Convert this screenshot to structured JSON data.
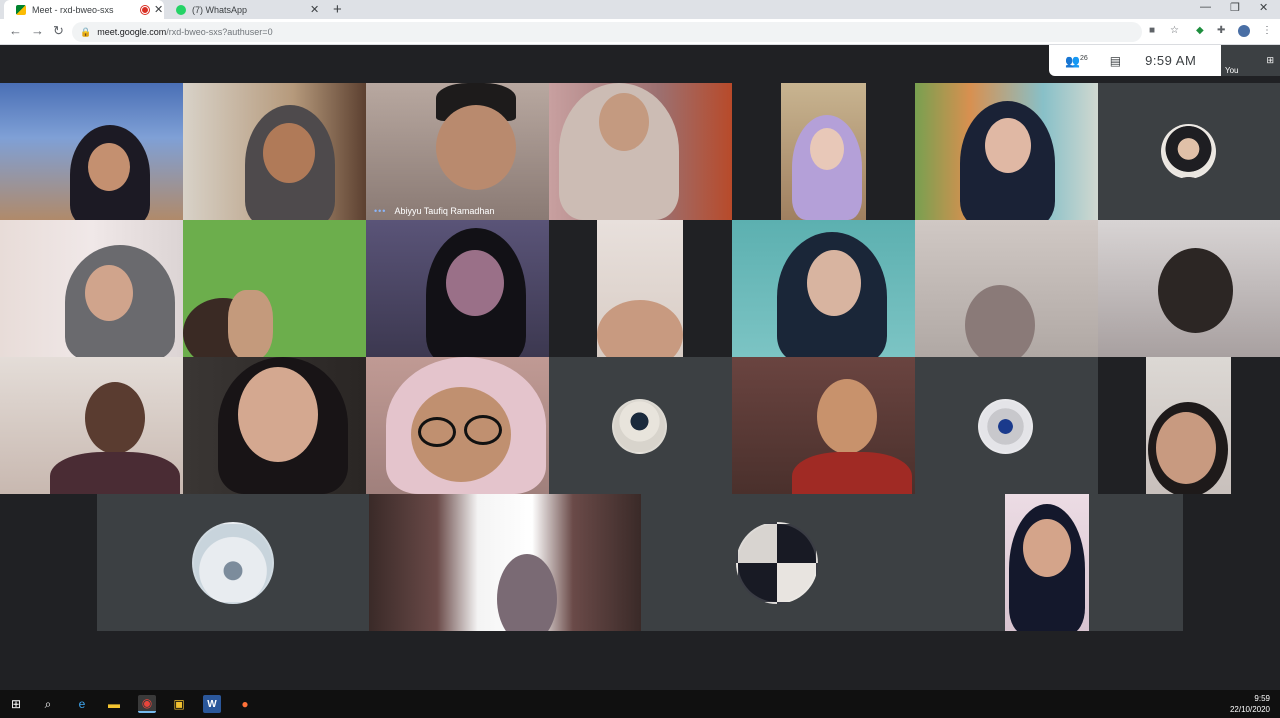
{
  "browser": {
    "tabs": [
      {
        "title": "Meet - rxd-bweo-sxs",
        "active": true,
        "recording": true
      },
      {
        "title": "(7) WhatsApp",
        "active": false,
        "recording": false
      }
    ],
    "url_host": "meet.google.com",
    "url_path": "/rxd-bweo-sxs?authuser=0"
  },
  "meet": {
    "participant_count": "26",
    "clock": "9:59  AM",
    "self_label": "You",
    "speaker_name": "Abiyyu Taufiq Ramadhan"
  },
  "taskbar": {
    "time": "9:59",
    "date": "22/10/2020"
  },
  "colors": {
    "meet_bg": "#202124",
    "tile_bg": "#3c4043",
    "speaking_accent": "#81e6d9",
    "chrome_tabstrip": "#dee1e6"
  }
}
